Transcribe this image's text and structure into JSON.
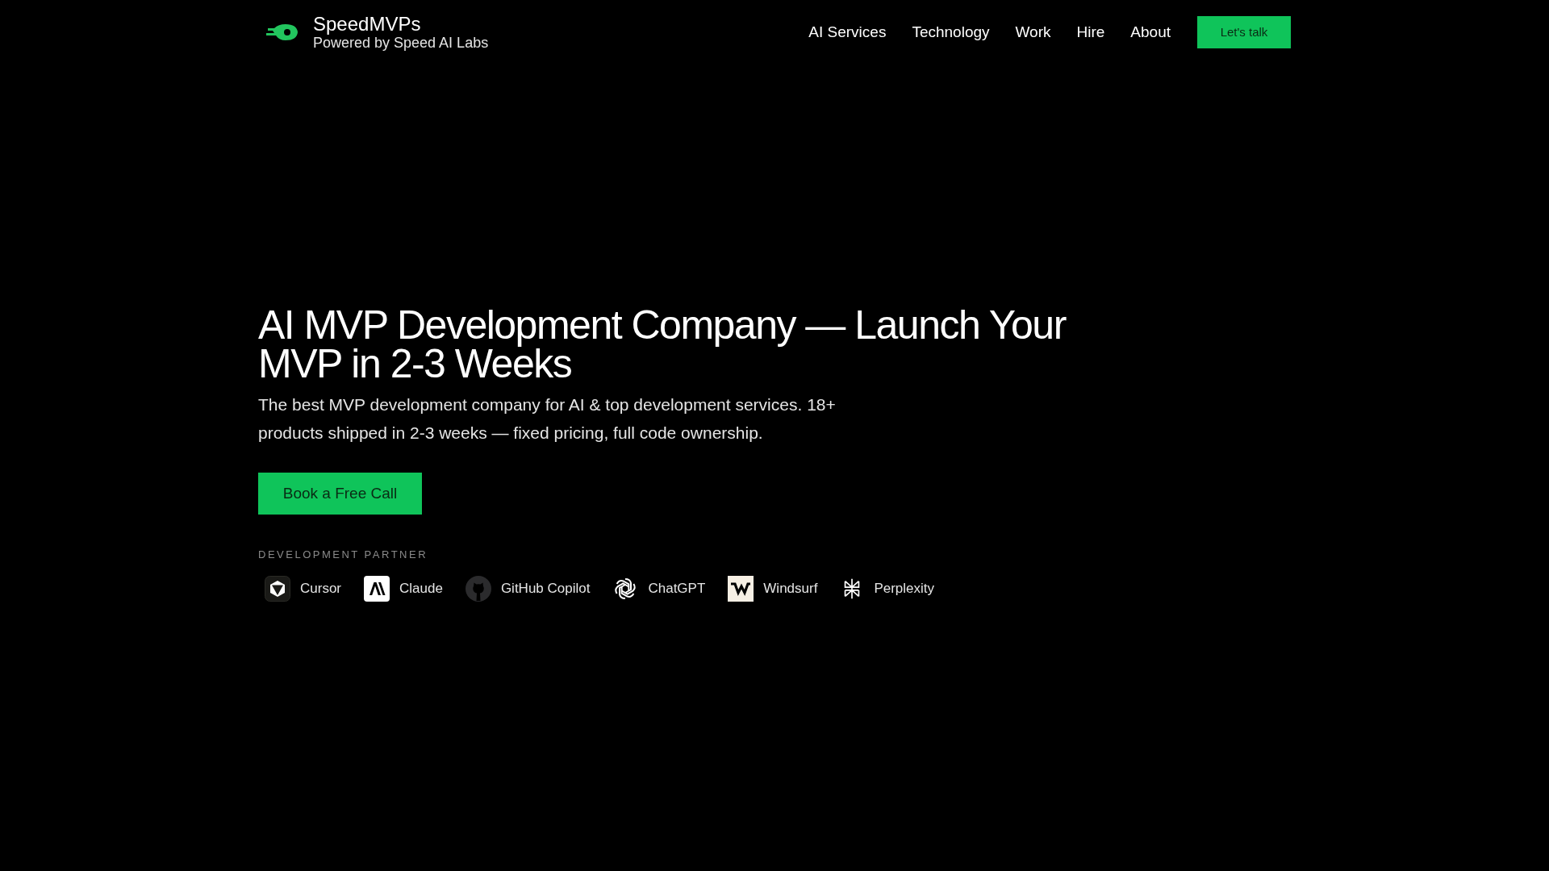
{
  "brand": {
    "name": "SpeedMVPs",
    "tagline": "Powered by Speed AI Labs"
  },
  "nav": {
    "links": [
      "AI Services",
      "Technology",
      "Work",
      "Hire",
      "About"
    ],
    "cta": "Let's talk"
  },
  "hero": {
    "title": "AI MVP Development Company — Launch Your MVP in 2-3 Weeks",
    "subtitle": "The best MVP development company for AI & top development services. 18+ products shipped in 2-3 weeks — fixed pricing, full code ownership.",
    "cta": "Book a Free Call"
  },
  "partners": {
    "label": "DEVELOPMENT PARTNER",
    "items": [
      {
        "name": "Cursor"
      },
      {
        "name": "Claude"
      },
      {
        "name": "GitHub Copilot"
      },
      {
        "name": "ChatGPT"
      },
      {
        "name": "Windsurf"
      },
      {
        "name": "Perplexity"
      }
    ]
  }
}
